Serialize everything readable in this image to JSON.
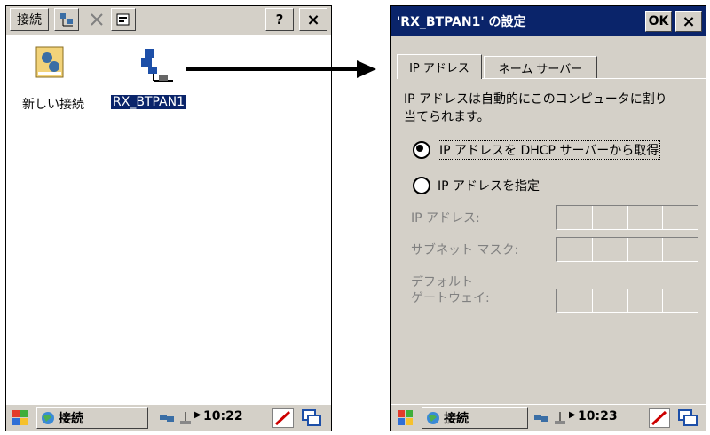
{
  "left_screen": {
    "toolbar": {
      "connect_label": "接続",
      "help_label": "?",
      "close_label": "×"
    },
    "icons": [
      {
        "label": "新しい接続"
      },
      {
        "label": "RX_BTPAN1"
      }
    ],
    "taskbar": {
      "task_label": "接続",
      "time": "10:22"
    }
  },
  "right_screen": {
    "dialog": {
      "title": "'RX_BTPAN1' の設定",
      "ok_label": "OK",
      "close_label": "×"
    },
    "tabs": [
      {
        "label": "IP アドレス",
        "active": true
      },
      {
        "label": "ネーム サーバー",
        "active": false
      }
    ],
    "description": "IP アドレスは自動的にこのコンピュータに割り当てられます。",
    "description_line1": "IP アドレスは自動的にこのコンピュータに割り",
    "description_line2": "当てられます。",
    "radio_dhcp": {
      "label": "IP アドレスを DHCP サーバーから取得",
      "selected": true
    },
    "radio_manual": {
      "label": "IP アドレスを指定",
      "selected": false
    },
    "fields": {
      "ip_label": "IP アドレス:",
      "subnet_label": "サブネット マスク:",
      "gateway_label_line1": "デフォルト",
      "gateway_label_line2": "ゲートウェイ:"
    },
    "taskbar": {
      "task_label": "接続",
      "time": "10:23"
    }
  },
  "colors": {
    "selection": "#0a246a",
    "chrome": "#d4d0c8"
  }
}
